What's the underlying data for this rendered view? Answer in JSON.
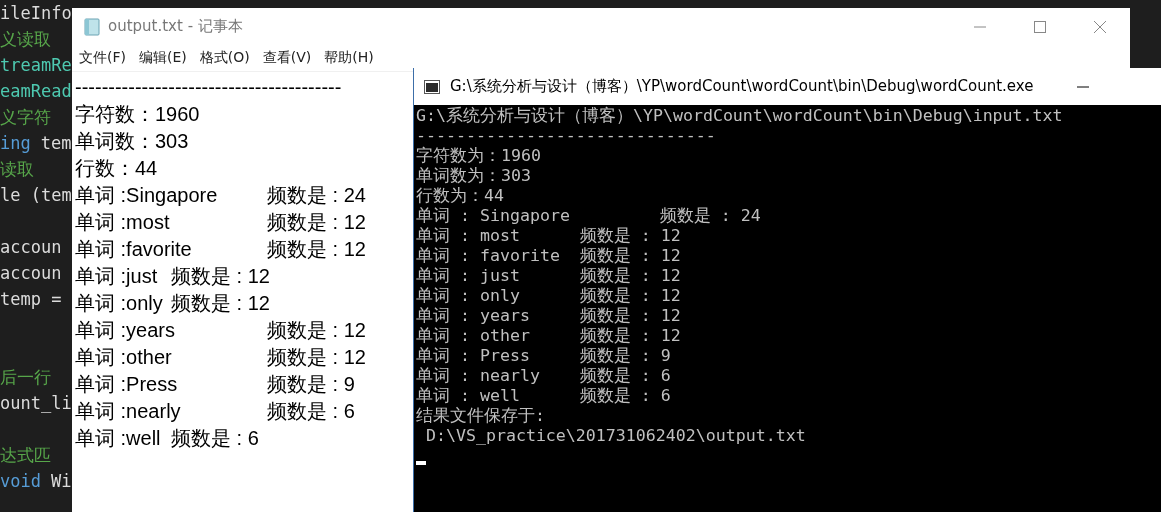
{
  "code_editor": {
    "lines": [
      {
        "kind": "code",
        "segments": [
          {
            "text": "ileInfo",
            "kind": "plain"
          }
        ]
      },
      {
        "kind": "code",
        "segments": [
          {
            "text": "义读取",
            "kind": "comment"
          }
        ]
      },
      {
        "kind": "code",
        "segments": [
          {
            "text": "treamRe",
            "kind": "type"
          }
        ]
      },
      {
        "kind": "code",
        "segments": [
          {
            "text": "eamRead",
            "kind": "type"
          }
        ]
      },
      {
        "kind": "code",
        "segments": [
          {
            "text": "义字符",
            "kind": "comment"
          }
        ]
      },
      {
        "kind": "code",
        "segments": [
          {
            "text": "ing",
            "kind": "keyword"
          },
          {
            "text": "tem",
            "kind": "plain"
          }
        ]
      },
      {
        "kind": "code",
        "segments": [
          {
            "text": "读取",
            "kind": "comment"
          }
        ]
      },
      {
        "kind": "code",
        "segments": [
          {
            "text": "le (tem",
            "kind": "plain"
          }
        ]
      },
      {
        "kind": "blank"
      },
      {
        "kind": "code",
        "segments": [
          {
            "text": "accoun",
            "kind": "plain"
          }
        ]
      },
      {
        "kind": "code",
        "segments": [
          {
            "text": "accoun",
            "kind": "plain"
          }
        ]
      },
      {
        "kind": "code",
        "segments": [
          {
            "text": "temp =",
            "kind": "plain"
          }
        ]
      },
      {
        "kind": "blank"
      },
      {
        "kind": "blank"
      },
      {
        "kind": "code",
        "segments": [
          {
            "text": "后一行",
            "kind": "comment"
          }
        ]
      },
      {
        "kind": "code",
        "segments": [
          {
            "text": "ount_li",
            "kind": "plain"
          }
        ]
      },
      {
        "kind": "blank"
      },
      {
        "kind": "code",
        "segments": [
          {
            "text": "达式匹",
            "kind": "comment"
          }
        ]
      },
      {
        "kind": "code",
        "segments": [
          {
            "text": "void",
            "kind": "keyword"
          },
          {
            "text": "Wi",
            "kind": "plain"
          }
        ]
      }
    ]
  },
  "notepad": {
    "title": "output.txt - 记事本",
    "menu": [
      "文件(F)",
      "编辑(E)",
      "格式(O)",
      "查看(V)",
      "帮助(H)"
    ],
    "lines": [
      "----------------------------------------",
      "字符数：1960",
      "单词数：303",
      "行数：44",
      "单词 :Singapore\t频数是 : 24",
      "单词 :most\t频数是 : 12",
      "单词 :favorite\t频数是 : 12",
      "单词 :just\t频数是 : 12",
      "单词 :only\t频数是 : 12",
      "单词 :years\t频数是 : 12",
      "单词 :other\t频数是 : 12",
      "单词 :Press\t频数是 : 9",
      "单词 :nearly\t频数是 : 6",
      "单词 :well\t频数是 : 6"
    ]
  },
  "console": {
    "title": "G:\\系统分析与设计（博客）\\YP\\wordCount\\wordCount\\bin\\Debug\\wordCount.exe",
    "lines": [
      "G:\\系统分析与设计（博客）\\YP\\wordCount\\wordCount\\bin\\Debug\\input.txt",
      "------------------------------",
      "字符数为：1960",
      "单词数为：303",
      "行数为：44",
      "单词 : Singapore         频数是 : 24",
      "单词 : most      频数是 : 12",
      "单词 : favorite  频数是 : 12",
      "单词 : just      频数是 : 12",
      "单词 : only      频数是 : 12",
      "单词 : years     频数是 : 12",
      "单词 : other     频数是 : 12",
      "单词 : Press     频数是 : 9",
      "单词 : nearly    频数是 : 6",
      "单词 : well      频数是 : 6",
      "结果文件保存于:",
      " D:\\VS_practice\\201731062402\\output.txt"
    ]
  }
}
